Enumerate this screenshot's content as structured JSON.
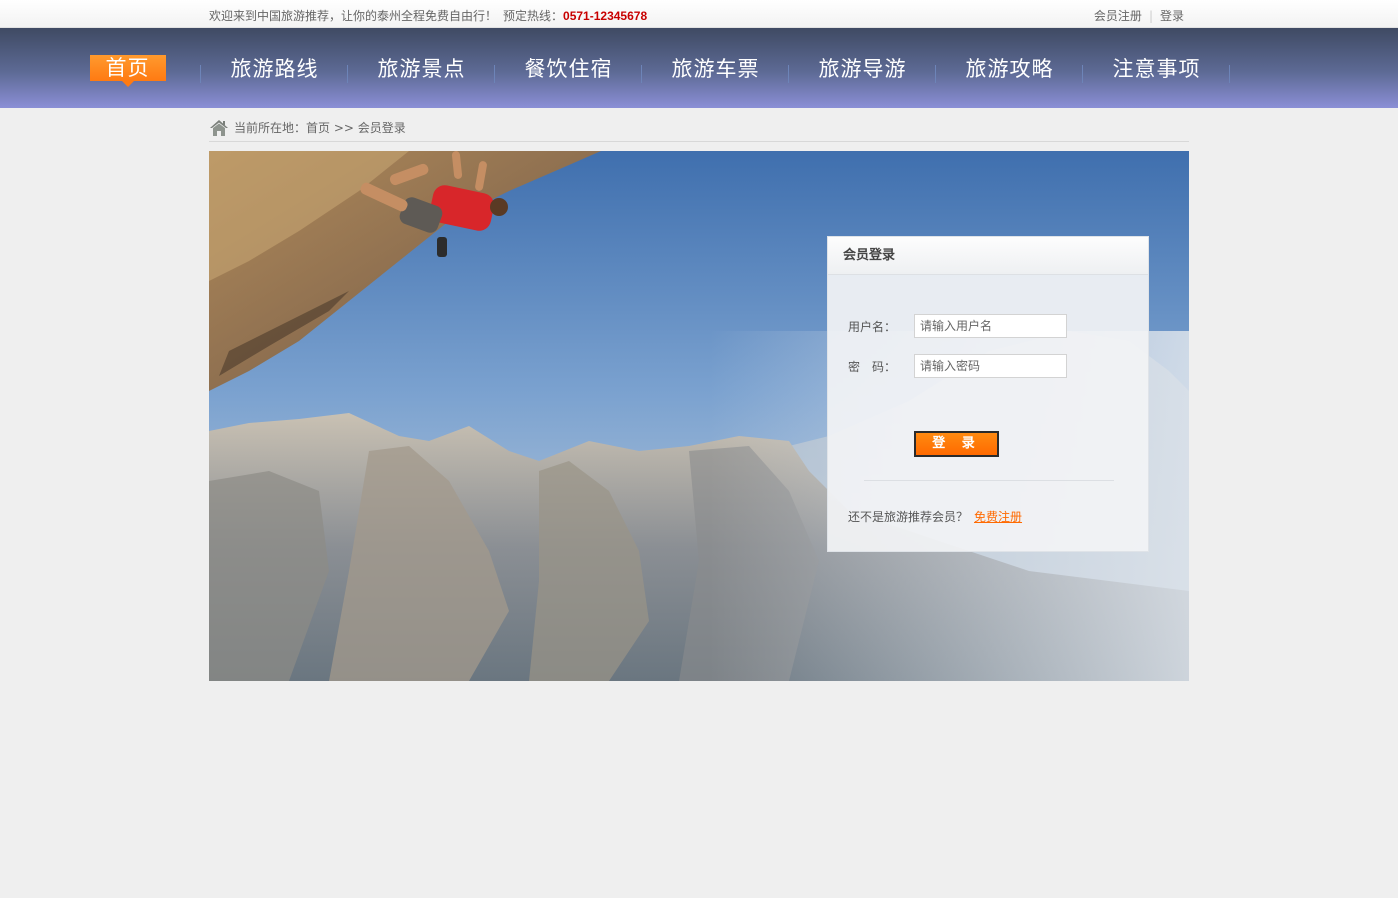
{
  "topbar": {
    "welcome": "欢迎来到中国旅游推荐，让你的泰州全程免费自由行！",
    "hotline_label": "预定热线：",
    "hotline": "0571-12345678",
    "register_link": "会员注册",
    "separator": "|",
    "login_link": "登录"
  },
  "nav": {
    "items": [
      {
        "label": "首页"
      },
      {
        "label": "旅游路线"
      },
      {
        "label": "旅游景点"
      },
      {
        "label": "餐饮住宿"
      },
      {
        "label": "旅游车票"
      },
      {
        "label": "旅游导游"
      },
      {
        "label": "旅游攻略"
      },
      {
        "label": "注意事项"
      }
    ],
    "active_index": 0,
    "active_color": "#ff7a12"
  },
  "breadcrumb": {
    "text": "当前所在地：首页 >> 会员登录"
  },
  "login": {
    "title": "会员登录",
    "username_label": "用户名：",
    "username_placeholder": "请输入用户名",
    "password_label": "密　码：",
    "password_placeholder": "请输入密码",
    "submit_label": "登 录",
    "register_prompt": "还不是旅游推荐会员？",
    "register_link": "免费注册"
  }
}
